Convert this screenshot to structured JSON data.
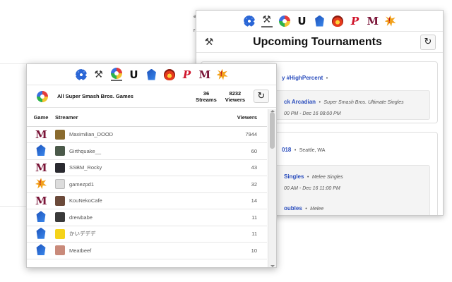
{
  "tabs_back": [
    {
      "icon": "gear-icon"
    },
    {
      "icon": "crossed-axes-icon",
      "glyph": "⚒"
    },
    {
      "icon": "smash-ball-icon"
    },
    {
      "icon": "ultimate-u-icon",
      "glyph": "U"
    },
    {
      "icon": "blue-crest-icon"
    },
    {
      "icon": "red-emblem-icon"
    },
    {
      "icon": "p-logo-icon",
      "glyph": "P"
    },
    {
      "icon": "melee-m-icon",
      "glyph": "M"
    },
    {
      "icon": "burst-icon"
    }
  ],
  "tournaments": {
    "title": "Upcoming Tournaments",
    "refresh_glyph": "↻",
    "axes_glyph": "⚒",
    "card1": {
      "name": "y #HighPercent",
      "sep": "•",
      "event": {
        "name": "ck Arcadian",
        "sep": "•",
        "game": "Super Smash Bros. Ultimate Singles",
        "time": "00 PM - Dec 16 08:00 PM"
      }
    },
    "card2": {
      "name": "018",
      "sep": "•",
      "location": "Seattle, WA",
      "events": [
        {
          "name": "Singles",
          "sep": "•",
          "game": "Melee Singles",
          "time": "00 AM - Dec 16 11:00 PM"
        },
        {
          "name": "oubles",
          "sep": "•",
          "game": "Melee"
        }
      ]
    }
  },
  "streams": {
    "game_title": "All Super Smash Bros. Games",
    "streams_count": "36",
    "streams_label": "Streams",
    "viewers_count": "8232",
    "viewers_label": "Viewers",
    "refresh_glyph": "↻",
    "headers": {
      "game": "Game",
      "streamer": "Streamer",
      "viewers": "Viewers"
    },
    "rows": [
      {
        "game_glyph": "M",
        "game_icon": "melee-m-icon",
        "streamer": "Maximilian_DOOD",
        "viewers": "7944",
        "avatar_color": "#8a6b2e"
      },
      {
        "game_icon": "blue-crest-icon",
        "streamer": "Girthquake__",
        "viewers": "60",
        "avatar_color": "#4b5a4a"
      },
      {
        "game_glyph": "M",
        "game_icon": "melee-m-icon",
        "streamer": "SSBM_Rocky",
        "viewers": "43",
        "avatar_color": "#2a2a30"
      },
      {
        "game_icon": "burst-icon",
        "streamer": "gamezpd1",
        "viewers": "32",
        "avatar_color": "#dcdcdc"
      },
      {
        "game_glyph": "M",
        "game_icon": "melee-m-icon",
        "streamer": "KouNekoCafe",
        "viewers": "14",
        "avatar_color": "#6b4a3a"
      },
      {
        "game_icon": "blue-crest-icon",
        "streamer": "drewbabe",
        "viewers": "11",
        "avatar_color": "#3a3a3a"
      },
      {
        "game_icon": "blue-crest-icon",
        "streamer": "かいデデデ",
        "viewers": "11",
        "avatar_color": "#f5d31a"
      },
      {
        "game_icon": "blue-crest-icon",
        "streamer": "Meatbeef",
        "viewers": "10",
        "avatar_color": "#c98a7a"
      }
    ]
  },
  "stray": {
    "top": "ə",
    "right": "r"
  },
  "colors": {
    "link_blue": "#2a4dbd",
    "border": "#c9c9c9"
  }
}
